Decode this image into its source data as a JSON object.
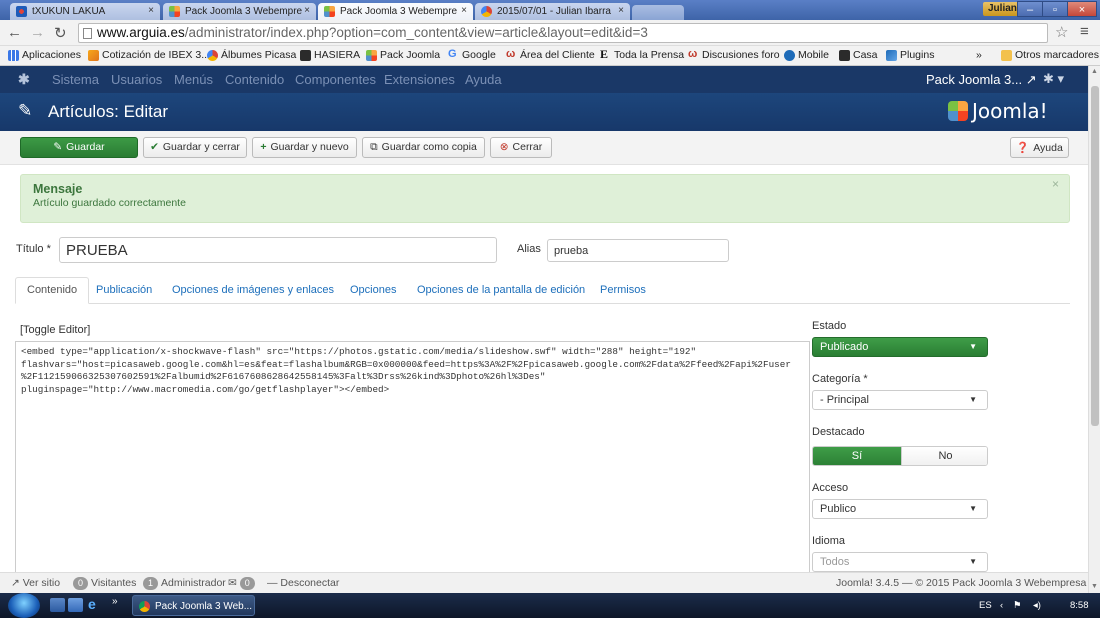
{
  "browser": {
    "tabs": [
      {
        "label": "tXUKUN LAKUA",
        "active": false
      },
      {
        "label": "Pack Joomla 3 Webempre",
        "active": false
      },
      {
        "label": "Pack Joomla 3 Webempre",
        "active": true
      },
      {
        "label": "2015/07/01 - Julian Ibarra",
        "active": false
      }
    ],
    "window_user": "Julian",
    "url_host": "www.arguia.es",
    "url_path": "/administrator/index.php?option=com_content&view=article&layout=edit&id=3",
    "bookmarks": [
      "Aplicaciones",
      "Cotización de IBEX 3...",
      "Álbumes Picasa",
      "HASIERA",
      "Pack Joomla",
      "Google",
      "Área del Cliente",
      "Toda la Prensa",
      "Discusiones foro",
      "Mobile",
      "Casa",
      "Plugins"
    ],
    "bookmarks_overflow": "»",
    "other_bookmarks": "Otros marcadores"
  },
  "joomla": {
    "menu": [
      "Sistema",
      "Usuarios",
      "Menús",
      "Contenido",
      "Componentes",
      "Extensiones",
      "Ayuda"
    ],
    "site_link": "Pack Joomla 3...",
    "page_title": "Artículos: Editar",
    "brand": "Joomla!",
    "toolbar": {
      "save": "Guardar",
      "save_close": "Guardar y cerrar",
      "save_new": "Guardar y nuevo",
      "save_copy": "Guardar como copia",
      "close": "Cerrar",
      "help": "Ayuda"
    },
    "message": {
      "heading": "Mensaje",
      "text": "Artículo guardado correctamente",
      "close": "×"
    },
    "form": {
      "title_label": "Título *",
      "title_value": "PRUEBA",
      "alias_label": "Alias",
      "alias_value": "prueba"
    },
    "tabs": [
      "Contenido",
      "Publicación",
      "Opciones de imágenes y enlaces",
      "Opciones",
      "Opciones de la pantalla de edición",
      "Permisos"
    ],
    "toggle_editor": "[Toggle Editor]",
    "editor_content": "<embed type=\"application/x-shockwave-flash\" src=\"https://photos.gstatic.com/media/slideshow.swf\" width=\"288\" height=\"192\"\nflashvars=\"host=picasaweb.google.com&hl=es&feat=flashalbum&RGB=0x000000&feed=https%3A%2F%2Fpicasaweb.google.com%2Fdata%2Ffeed%2Fapi%2Fuser\n%2F112159066325307602591%2Falbumid%2F6167608628642558145%3Falt%3Drss%26kind%3Dphoto%26hl%3Des\"\npluginspage=\"http://www.macromedia.com/go/getflashplayer\"></embed>",
    "sidebar": {
      "status_label": "Estado",
      "status_value": "Publicado",
      "category_label": "Categoría *",
      "category_value": "- Principal",
      "featured_label": "Destacado",
      "featured_yes": "Sí",
      "featured_no": "No",
      "access_label": "Acceso",
      "access_value": "Publico",
      "language_label": "Idioma",
      "language_value": "Todos"
    },
    "statusbar": {
      "view_site": "Ver sitio",
      "visitors_count": "0",
      "visitors_label": "Visitantes",
      "admins_count": "1",
      "admins_label": "Administrador",
      "messages_count": "0",
      "logout": "Desconectar",
      "footer": "Joomla! 3.4.5 — © 2015 Pack Joomla 3 Webempresa"
    }
  },
  "taskbar": {
    "task": "Pack Joomla 3 Web...",
    "lang": "ES",
    "time": "8:58"
  }
}
